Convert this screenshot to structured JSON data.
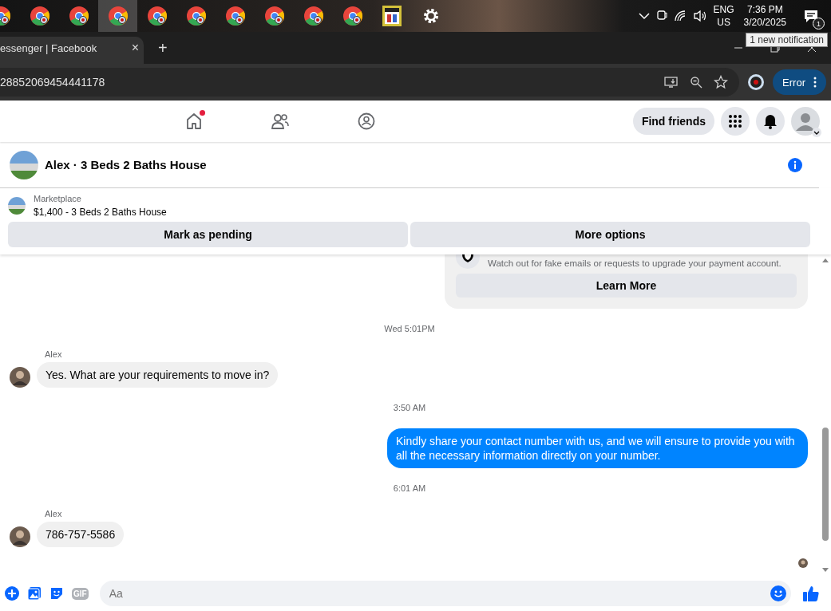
{
  "taskbar": {
    "apps": [
      {
        "kind": "browser",
        "selected": false
      },
      {
        "kind": "browser",
        "selected": false
      },
      {
        "kind": "browser",
        "selected": false
      },
      {
        "kind": "browser",
        "selected": true
      },
      {
        "kind": "browser",
        "selected": false
      },
      {
        "kind": "browser",
        "selected": false
      },
      {
        "kind": "browser",
        "selected": false
      },
      {
        "kind": "browser",
        "selected": false
      },
      {
        "kind": "browser",
        "selected": false
      },
      {
        "kind": "browser",
        "selected": false
      },
      {
        "kind": "media",
        "selected": false
      },
      {
        "kind": "settings",
        "selected": false
      }
    ],
    "language": "ENG",
    "region": "US",
    "time": "7:36 PM",
    "date": "3/20/2025",
    "notification_count": "1",
    "tooltip": "1 new notification"
  },
  "browser": {
    "tab_title": "essenger | Facebook",
    "tab_close": "×",
    "new_tab": "+",
    "url": "28852069454441178",
    "profile_button": "Error"
  },
  "nav": {
    "home_notification": true,
    "find_friends": "Find friends"
  },
  "conversation": {
    "title": "Alex · 3 Beds 2 Baths House",
    "listing_label": "Marketplace",
    "listing_title": "$1,400 - 3 Beds 2 Baths House",
    "actions": [
      "Mark as pending",
      "More options"
    ]
  },
  "messages": [
    {
      "kind": "notice",
      "text": "Watch out for fake emails or requests to upgrade your payment account.",
      "button": "Learn More"
    },
    {
      "kind": "time",
      "text": "Wed 5:01PM"
    },
    {
      "kind": "incoming",
      "sender": "Alex",
      "text": "Yes. What are your requirements to move in?"
    },
    {
      "kind": "time",
      "text": "3:50 AM"
    },
    {
      "kind": "outgoing",
      "text": "Kindly share your contact number with us, and we will ensure to provide you with all the necessary information directly on your number."
    },
    {
      "kind": "time",
      "text": "6:01 AM"
    },
    {
      "kind": "incoming",
      "sender": "Alex",
      "text": "786-757-5586"
    }
  ],
  "composer": {
    "gif": "GIF",
    "placeholder": "Aa"
  }
}
